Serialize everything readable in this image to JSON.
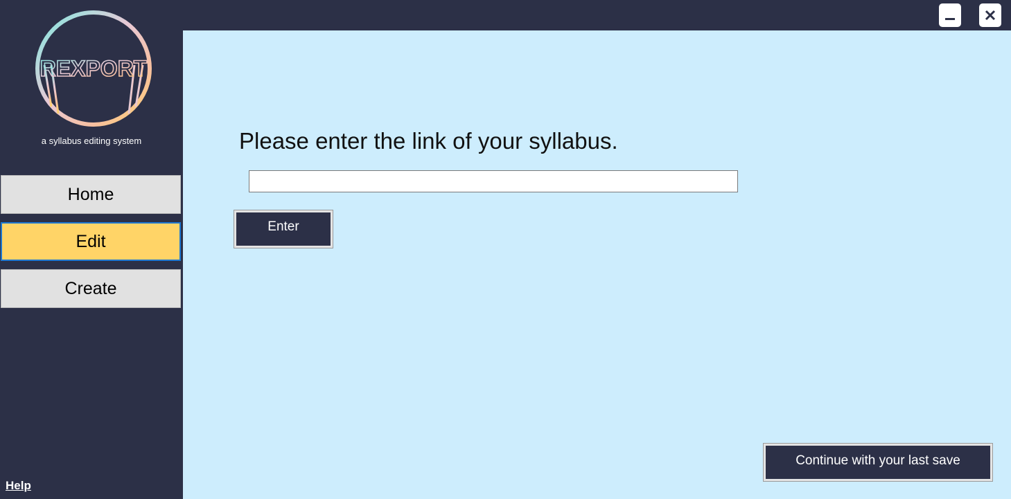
{
  "app": {
    "logo_text": "REXPORT",
    "tagline": "a syllabus editing system"
  },
  "window_controls": {
    "minimize_icon": "minimize-icon",
    "close_icon": "close-icon"
  },
  "sidebar": {
    "items": [
      {
        "label": "Home",
        "selected": false
      },
      {
        "label": "Edit",
        "selected": true
      },
      {
        "label": "Create",
        "selected": false
      }
    ],
    "help_label": "Help"
  },
  "main": {
    "prompt": "Please enter the link of your syllabus.",
    "link_input": {
      "value": "",
      "placeholder": ""
    },
    "enter_label": "Enter",
    "continue_label": "Continue with your last save"
  },
  "colors": {
    "sidebar_bg": "#2c3047",
    "main_bg": "#cdedfd",
    "selected_nav": "#ffd467",
    "nav_bg": "#e1e1e1",
    "button_bg": "#2c3047"
  }
}
